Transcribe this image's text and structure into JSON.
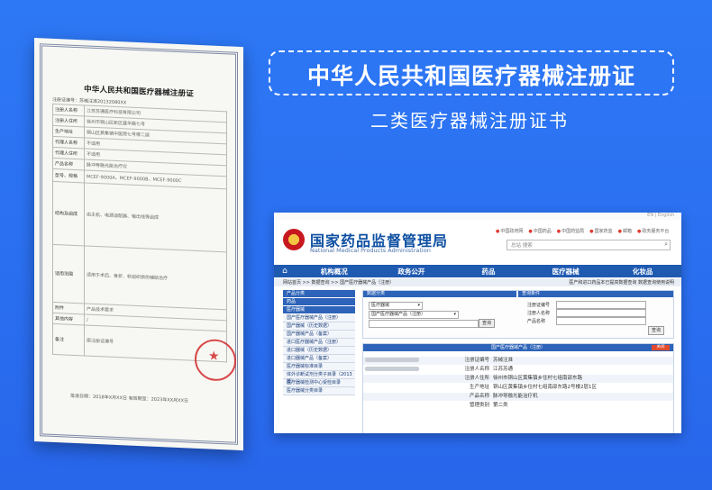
{
  "banner": {
    "title": "中华人民共和国医疗器械注册证",
    "subtitle": "二类医疗器械注册证书"
  },
  "certificate": {
    "heading": "中华人民共和国医疗器械注册证",
    "reg_number": "注册证编号：苏械注准20132080XX",
    "rows": [
      {
        "k": "注册人名称",
        "v": "江苏苏通医疗科技有限公司"
      },
      {
        "k": "注册人住所",
        "v": "徐州市铜山区新区盛华路七号"
      },
      {
        "k": "生产地址",
        "v": "铜山区黄集镇中医院七号楼二层"
      },
      {
        "k": "代理人名称",
        "v": "不适用"
      },
      {
        "k": "代理人住所",
        "v": "不适用"
      },
      {
        "k": "产品名称",
        "v": "脉冲导融光能治疗仪"
      },
      {
        "k": "型号、规格",
        "v": "MCEF-9000A、MCEF-9000B、MCEF-9000C"
      },
      {
        "k": "结构及组成",
        "v": "由主机、电源适配器、输出线等组成"
      },
      {
        "k": "适用范围",
        "v": "适用于术后、骨折、软组织损伤辅助治疗"
      },
      {
        "k": "附件",
        "v": "产品技术要求"
      },
      {
        "k": "其他内容",
        "v": "/"
      },
      {
        "k": "备注",
        "v": "原注册证编号"
      }
    ],
    "footer": "批准日期：2018年X月XX日   有效期至：2023年XX月XX日"
  },
  "site": {
    "top_right": "EN | English",
    "logo_cn": "国家药品监督管理局",
    "logo_en": "National Medical Products Administration",
    "top_links": [
      "中国政府网",
      "中国药品",
      "中国药监局",
      "国家药监",
      "邮箱",
      "政务服务平台"
    ],
    "search_placeholder": "总站 搜索",
    "nav": [
      "机构概况",
      "政务公开",
      "药品",
      "医疗器械",
      "化妆品"
    ],
    "crumb_left": "网站首页 >> 数据查询 >> 国产医疗器械产品（注册）",
    "crumb_right": "医产和进口药品本已提高数据查询 数据查询使用说明",
    "sidebar": {
      "headers": [
        "产品分类",
        "药品",
        "医疗器械"
      ],
      "items": [
        "国产医疗器械产品（注册）",
        "国产器械（历史数据）",
        "国产器械产品（备案）",
        "进口医疗器械产品（注册）",
        "进口器械（历史数据）",
        "进口器械产品（备案）",
        "医疗器械标准目录",
        "体外诊断试剂分类子目录（2013版）",
        "医疗器械检测中心受检目录",
        "医疗器械分类目录"
      ]
    },
    "panel": {
      "left_header": "数据分类",
      "right_header": "查询条件",
      "select1": "医疗器械",
      "select2": "国产医疗器械产品（注册）",
      "labels": [
        "注册证编号",
        "注册人名称",
        "产品名称"
      ],
      "query_btn": "查询"
    },
    "result": {
      "header": "国产医疗器械产品（注册）",
      "close_btn": "关闭",
      "rows": [
        {
          "k": "注册证编号",
          "v": "苏械注准"
        },
        {
          "k": "注册人名称",
          "v": "江苏苏通"
        },
        {
          "k": "注册人住所",
          "v": "徐州市铜山区黄集镇乡住村七组南邵东路"
        },
        {
          "k": "生产地址",
          "v": "铜山区黄集镇乡住村七组南邵东路2号楼2层1区"
        },
        {
          "k": "产品名称",
          "v": "脉冲导融光能治疗机"
        },
        {
          "k": "管理类别",
          "v": "第二类"
        }
      ]
    }
  },
  "colors": {
    "background": "#2a6ff0",
    "nav": "#1f5ab1",
    "seal": "#d12a2a"
  }
}
